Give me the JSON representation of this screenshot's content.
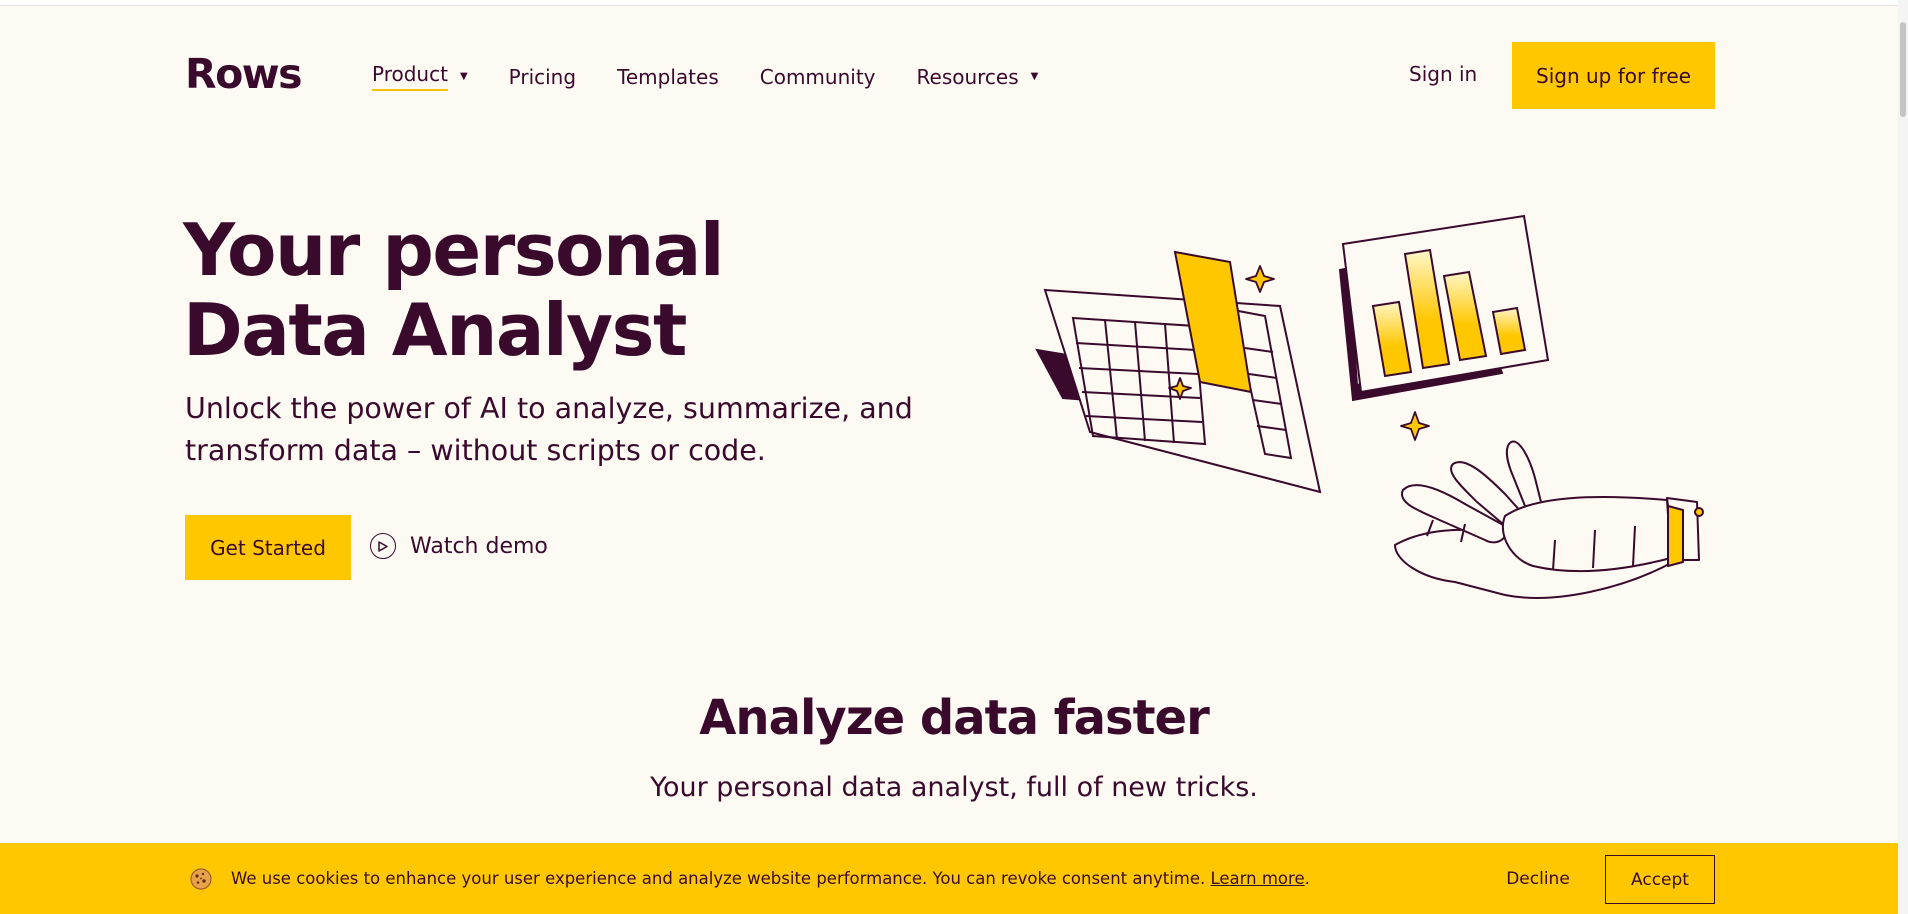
{
  "nav": {
    "logo": "Rows",
    "items": [
      {
        "label": "Product",
        "has_caret": true
      },
      {
        "label": "Pricing"
      },
      {
        "label": "Templates"
      },
      {
        "label": "Community"
      },
      {
        "label": "Resources",
        "has_caret": true
      }
    ],
    "signin": "Sign in",
    "signup": "Sign up for free"
  },
  "hero": {
    "title_line1": "Your personal",
    "title_line2": "Data Analyst",
    "sub_line1": "Unlock the power of AI to analyze, summarize, and",
    "sub_line2": "transform data – without scripts or code.",
    "cta": "Get Started",
    "demo": "Watch demo"
  },
  "section": {
    "title": "Analyze data faster",
    "subtitle": "Your personal data analyst, full of new tricks."
  },
  "cookie": {
    "text": "We use cookies to enhance your user experience and analyze website performance. You can revoke consent anytime.",
    "link": "Learn more",
    "period": ".",
    "decline": "Decline",
    "accept": "Accept"
  },
  "colors": {
    "brand": "#3a0a2c",
    "accent": "#ffc700",
    "background": "#fcfaf3"
  }
}
